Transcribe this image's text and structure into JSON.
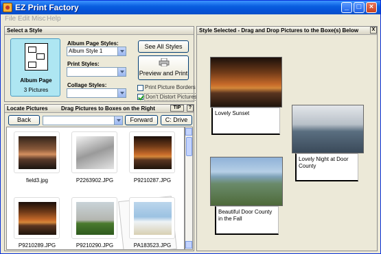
{
  "window": {
    "title": "EZ Print Factory"
  },
  "menu": [
    "File",
    "Edit",
    "Misc",
    "Help"
  ],
  "select_style": {
    "header": "Select a Style",
    "tile_title": "Album Page",
    "tile_count": "3 Pictures",
    "album_page_styles_label": "Album Page Styles:",
    "album_page_styles_value": "Album Style 1",
    "print_styles_label": "Print Styles:",
    "print_styles_value": "",
    "collage_styles_label": "Collage Styles:",
    "collage_styles_value": "",
    "see_all_styles": "See All Styles",
    "preview_and_print": "Preview and Print",
    "print_picture_borders": "Print Picture Borders",
    "print_picture_borders_checked": false,
    "dont_distort_pictures": "Don't Distort Pictures",
    "dont_distort_pictures_checked": true
  },
  "locate": {
    "header": "Locate Pictures",
    "subheader": "Drag Pictures to Boxes on the Right",
    "tip": "TIP",
    "help": "?",
    "back": "Back",
    "path_value": "",
    "forward": "Forward",
    "c_drive": "C: Drive",
    "files": [
      {
        "name": "field3.jpg",
        "image": "sunset-b"
      },
      {
        "name": "P2263902.JPG",
        "image": "snow"
      },
      {
        "name": "P9210287.JPG",
        "image": "sunset-a"
      },
      {
        "name": "P9210289.JPG",
        "image": "sunset-a"
      },
      {
        "name": "P9210290.JPG",
        "image": "farm"
      },
      {
        "name": "PA183523.JPG",
        "image": "beach"
      }
    ]
  },
  "selected": {
    "header": "Style Selected - Drag and Drop Pictures to the Boxe(s) Below",
    "close": "X",
    "captions": {
      "c1": "Lovely Sunset",
      "c2": "Lovely Night at Door County",
      "c3": "Beautiful Door County in the Fall"
    }
  }
}
